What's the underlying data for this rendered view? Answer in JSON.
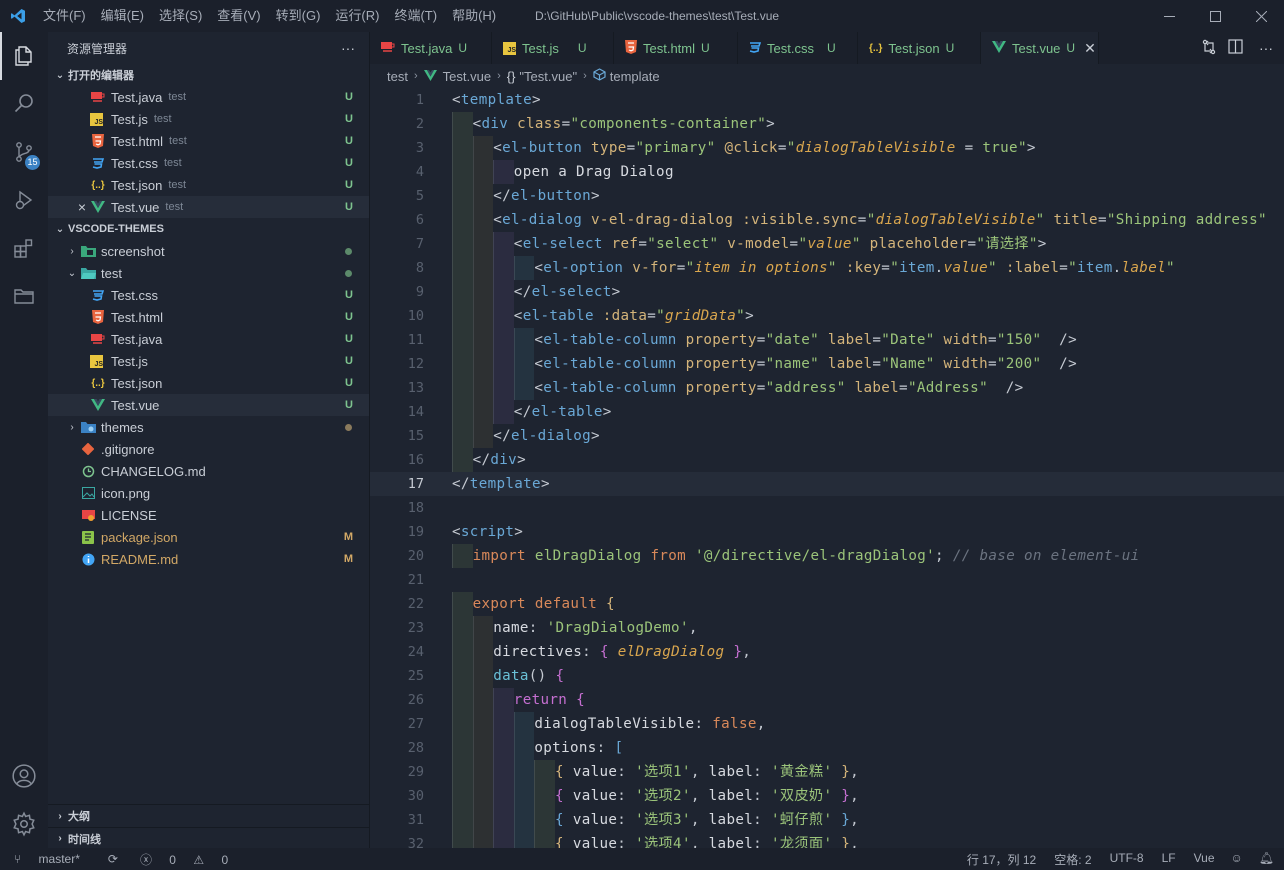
{
  "titlebar": {
    "menu": [
      "文件(F)",
      "编辑(E)",
      "选择(S)",
      "查看(V)",
      "转到(G)",
      "运行(R)",
      "终端(T)",
      "帮助(H)"
    ],
    "title": "D:\\GitHub\\Public\\vscode-themes\\test\\Test.vue"
  },
  "activity": {
    "scm_badge": "15"
  },
  "sidebar": {
    "title": "资源管理器",
    "open_editors_title": "打开的编辑器",
    "open_editors": [
      {
        "name": "Test.java",
        "desc": "test",
        "status": "U",
        "icon": "java-icon"
      },
      {
        "name": "Test.js",
        "desc": "test",
        "status": "U",
        "icon": "js-icon"
      },
      {
        "name": "Test.html",
        "desc": "test",
        "status": "U",
        "icon": "html-icon"
      },
      {
        "name": "Test.css",
        "desc": "test",
        "status": "U",
        "icon": "css-icon"
      },
      {
        "name": "Test.json",
        "desc": "test",
        "status": "U",
        "icon": "json-icon"
      },
      {
        "name": "Test.vue",
        "desc": "test",
        "status": "U",
        "icon": "vue-icon"
      }
    ],
    "workspace_title": "VSCODE-THEMES",
    "tree": {
      "screenshot": "screenshot",
      "test": "test",
      "test_files": [
        {
          "name": "Test.css",
          "status": "U"
        },
        {
          "name": "Test.html",
          "status": "U"
        },
        {
          "name": "Test.java",
          "status": "U"
        },
        {
          "name": "Test.js",
          "status": "U"
        },
        {
          "name": "Test.json",
          "status": "U"
        },
        {
          "name": "Test.vue",
          "status": "U"
        }
      ],
      "themes": "themes",
      "root_files": [
        {
          "name": ".gitignore",
          "status": ""
        },
        {
          "name": "CHANGELOG.md",
          "status": ""
        },
        {
          "name": "icon.png",
          "status": ""
        },
        {
          "name": "LICENSE",
          "status": ""
        },
        {
          "name": "package.json",
          "status": "M"
        },
        {
          "name": "README.md",
          "status": "M"
        }
      ]
    },
    "outline_title": "大纲",
    "timeline_title": "时间线"
  },
  "tabs": [
    {
      "label": "Test.java",
      "status": "U"
    },
    {
      "label": "Test.js",
      "status": "U"
    },
    {
      "label": "Test.html",
      "status": "U"
    },
    {
      "label": "Test.css",
      "status": "U"
    },
    {
      "label": "Test.json",
      "status": "U"
    },
    {
      "label": "Test.vue",
      "status": "U"
    }
  ],
  "breadcrumb": {
    "folder": "test",
    "file": "Test.vue",
    "scope": "\"Test.vue\"",
    "symbol": "template"
  },
  "editor": {
    "current_line": 17,
    "lines": [
      "1",
      "2",
      "3",
      "4",
      "5",
      "6",
      "7",
      "8",
      "9",
      "10",
      "11",
      "12",
      "13",
      "14",
      "15",
      "16",
      "17",
      "18",
      "19",
      "20",
      "21",
      "22",
      "23",
      "24",
      "25",
      "26",
      "27",
      "28",
      "29",
      "30",
      "31",
      "32"
    ]
  },
  "status": {
    "branch": "master*",
    "errors": "0",
    "warnings": "0",
    "position": "行 17，列 12",
    "spaces": "空格: 2",
    "encoding": "UTF-8",
    "eol": "LF",
    "language": "Vue"
  },
  "colors": {
    "accent": "#3b82c4",
    "vue": "#41b883",
    "untracked": "#7ec48f",
    "modified": "#d2a866"
  }
}
